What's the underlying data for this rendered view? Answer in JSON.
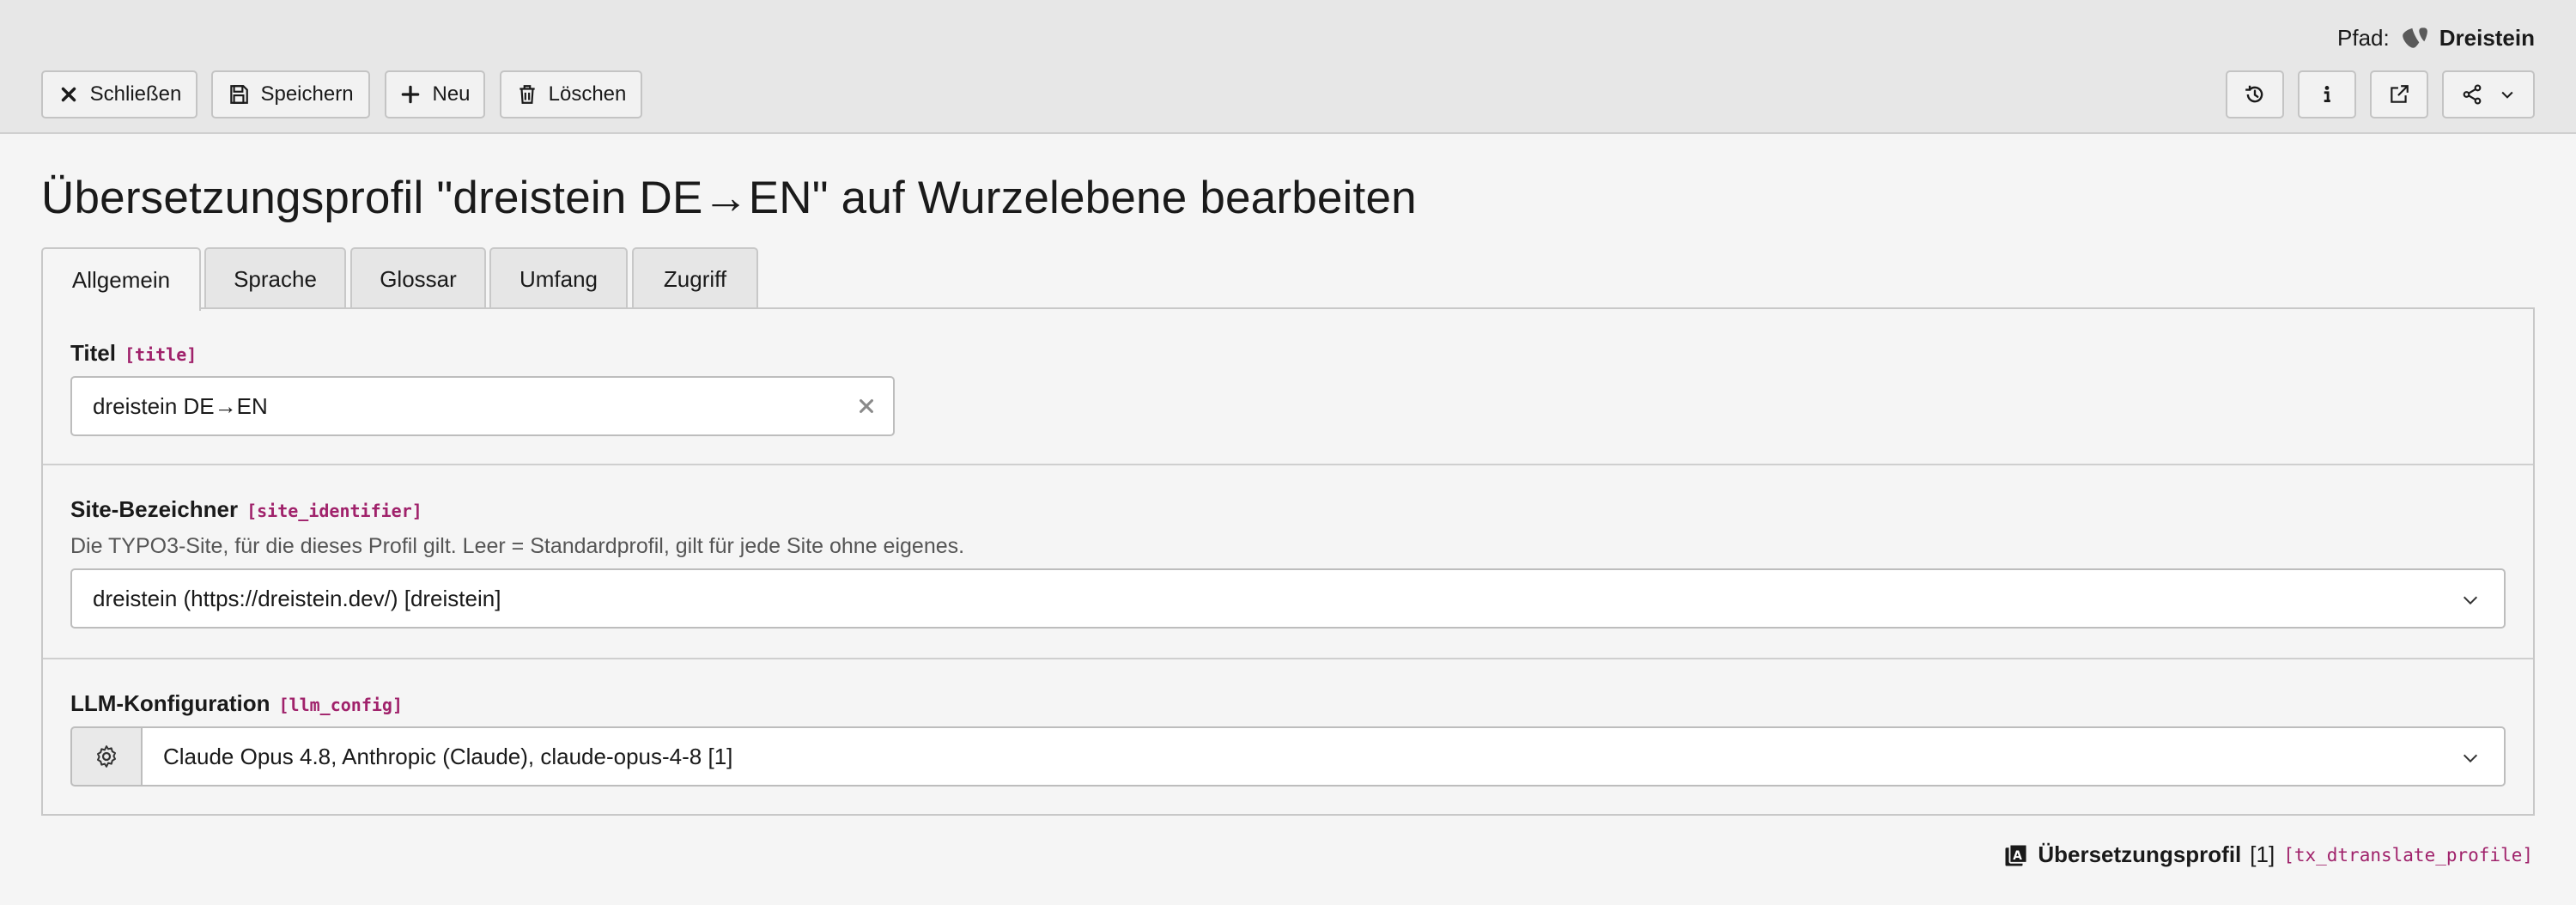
{
  "header": {
    "path_label": "Pfad:",
    "site_name": "Dreistein",
    "buttons": {
      "close": "Schließen",
      "save": "Speichern",
      "new": "Neu",
      "delete": "Löschen"
    },
    "right_icons": [
      "history-icon",
      "info-icon",
      "open-new-window-icon",
      "share-icon"
    ]
  },
  "page": {
    "title": "Übersetzungsprofil \"dreistein DE→EN\" auf Wurzelebene bearbeiten"
  },
  "tabs": [
    {
      "label": "Allgemein",
      "active": true
    },
    {
      "label": "Sprache",
      "active": false
    },
    {
      "label": "Glossar",
      "active": false
    },
    {
      "label": "Umfang",
      "active": false
    },
    {
      "label": "Zugriff",
      "active": false
    }
  ],
  "fields": {
    "title": {
      "label": "Titel",
      "key": "[title]",
      "value": "dreistein DE→EN"
    },
    "site_identifier": {
      "label": "Site-Bezeichner",
      "key": "[site_identifier]",
      "description": "Die TYPO3-Site, für die dieses Profil gilt. Leer = Standardprofil, gilt für jede Site ohne eigenes.",
      "value": "dreistein (https://dreistein.dev/) [dreistein]"
    },
    "llm_config": {
      "label": "LLM-Konfiguration",
      "key": "[llm_config]",
      "value": "Claude Opus 4.8, Anthropic (Claude), claude-opus-4-8 [1]"
    }
  },
  "footer": {
    "record_title": "Übersetzungsprofil",
    "record_uid": "[1]",
    "record_table": "[tx_dtranslate_profile]"
  },
  "colors": {
    "header_bg": "#e7e7e7",
    "page_bg": "#f5f5f5",
    "field_key": "#a0226b"
  }
}
